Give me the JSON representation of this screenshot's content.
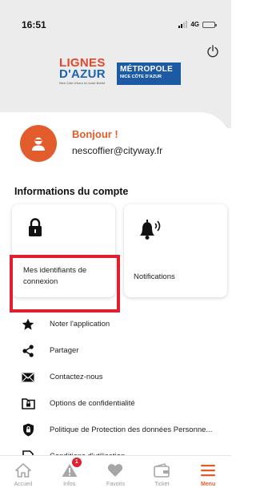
{
  "status_bar": {
    "time": "16:51",
    "network": "4G"
  },
  "logo": {
    "lignes_line1": "LIGNES",
    "lignes_line2": "D'AZUR",
    "lignes_tagline": "Nice Côte d'Azur en toute liberté",
    "metropole_line1": "MÉTROPOLE",
    "metropole_line2": "NICE CÔTE D'AZUR"
  },
  "profile": {
    "greeting": "Bonjour !",
    "email": "nescoffier@cityway.fr"
  },
  "section_title": "Informations du compte",
  "cards": [
    {
      "label": "Mes identifiants de connexion",
      "icon": "lock-icon"
    },
    {
      "label": "Notifications",
      "icon": "bell-ringing-icon"
    }
  ],
  "menu": [
    {
      "label": "Noter l'application",
      "icon": "star-icon"
    },
    {
      "label": "Partager",
      "icon": "share-icon"
    },
    {
      "label": "Contactez-nous",
      "icon": "envelope-icon"
    },
    {
      "label": "Options de confidentialité",
      "icon": "folder-lock-icon"
    },
    {
      "label": "Politique de Protection des données Personne...",
      "icon": "shield-lock-icon"
    },
    {
      "label": "Conditions d'utilisation",
      "icon": "document-icon"
    }
  ],
  "tabs": [
    {
      "label": "Accueil",
      "icon": "home-icon"
    },
    {
      "label": "Infos",
      "icon": "warning-icon",
      "badge": "1"
    },
    {
      "label": "Favoris",
      "icon": "heart-icon"
    },
    {
      "label": "Ticket",
      "icon": "wallet-icon"
    },
    {
      "label": "Menu",
      "icon": "menu-icon",
      "active": true
    }
  ],
  "colors": {
    "accent": "#e35d2c",
    "highlight": "#e0202e",
    "brand_blue": "#1c5aa3"
  }
}
